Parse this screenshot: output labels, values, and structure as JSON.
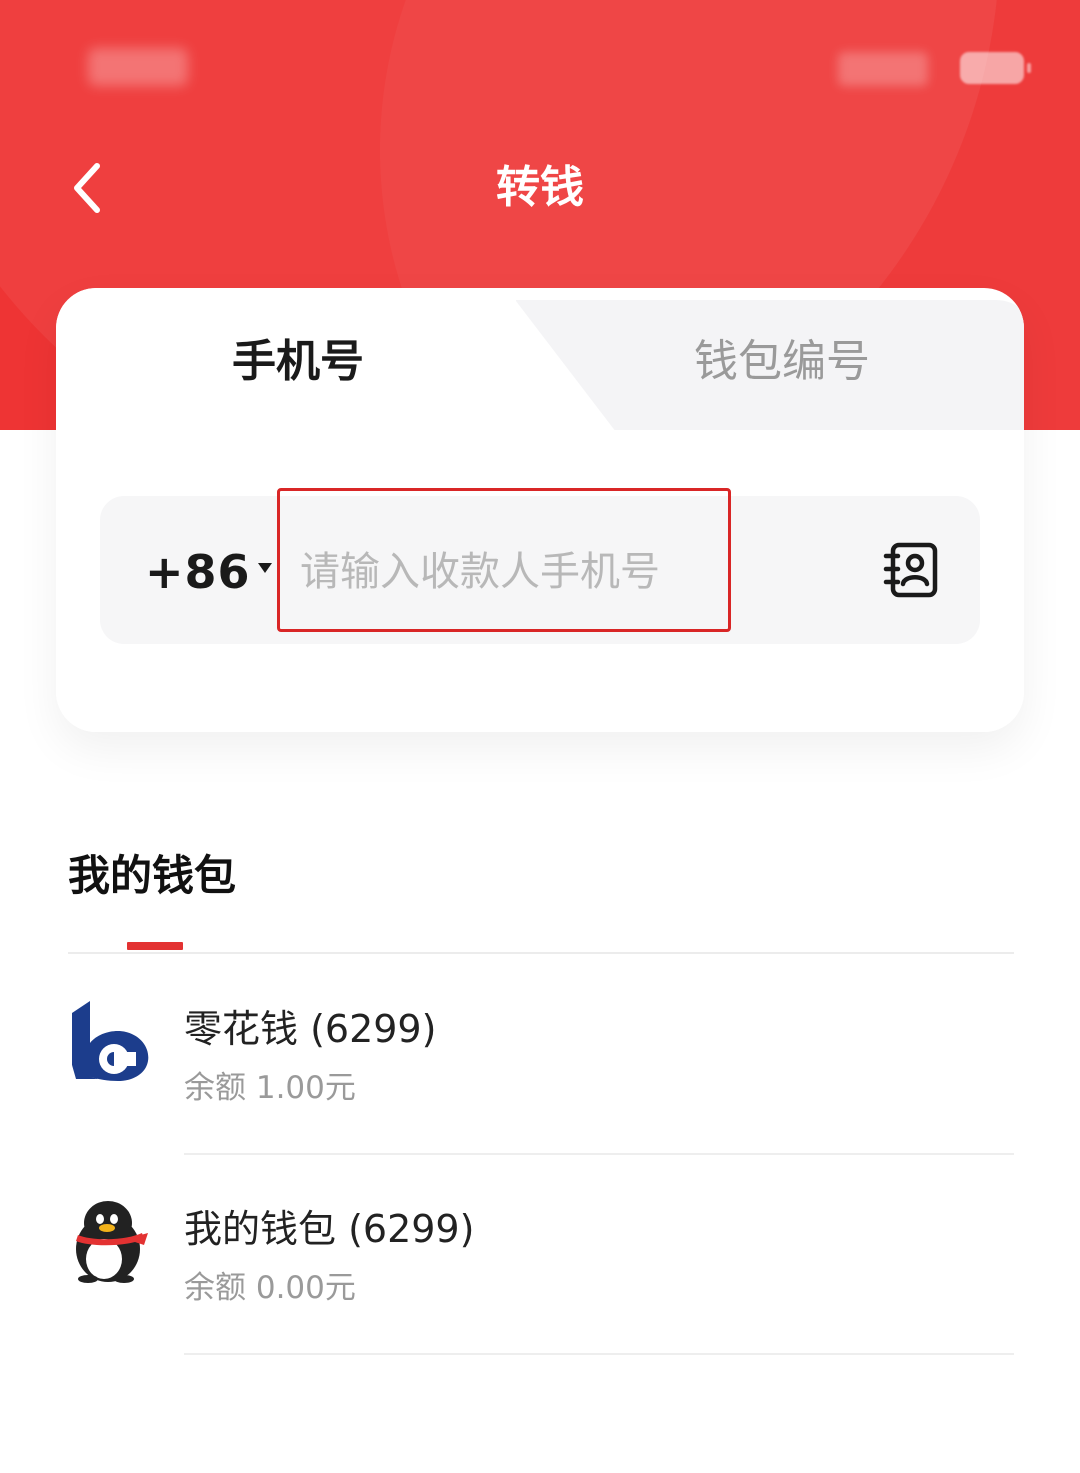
{
  "header": {
    "title": "转钱",
    "back_icon": "chevron-left-icon"
  },
  "tabs": [
    {
      "label": "手机号",
      "active": true
    },
    {
      "label": "钱包编号",
      "active": false
    }
  ],
  "phone_form": {
    "country_code": "+86",
    "phone_value": "",
    "phone_placeholder": "请输入收款人手机号",
    "contacts_icon": "contact-book-icon"
  },
  "wallets_section": {
    "title": "我的钱包",
    "items": [
      {
        "name": "零花钱 (6299)",
        "balance": "余额 1.00元",
        "icon": "bank-logo-icon"
      },
      {
        "name": "我的钱包 (6299)",
        "balance": "余额 0.00元",
        "icon": "penguin-icon"
      }
    ]
  },
  "colors": {
    "header_red": "#ee3434",
    "accent_red": "#e33232",
    "highlight_border": "#d92626",
    "bank_blue": "#1c3d8c",
    "text_primary": "#1a1a1a",
    "text_secondary": "#9a9a9a"
  }
}
